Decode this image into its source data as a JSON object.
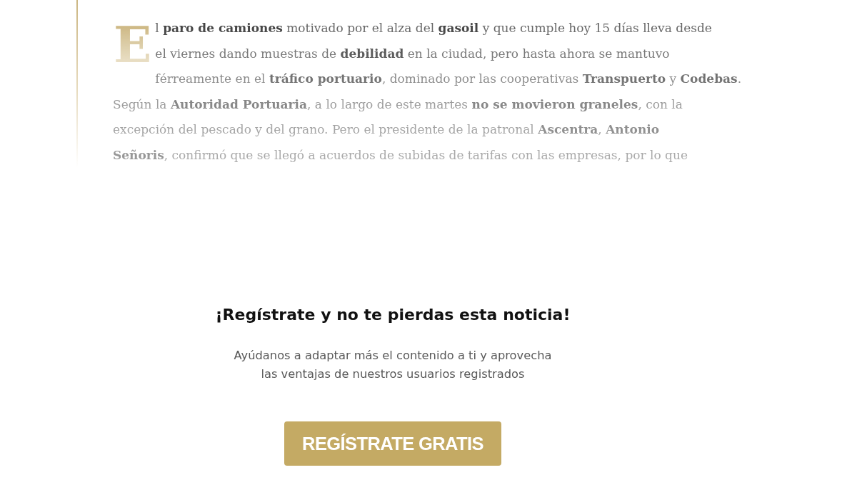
{
  "article": {
    "drop_cap": "E",
    "lines": [
      "l **paro de camiones** motivado por el alza del **gasoil** y que cumple hoy 15 días lleva desde",
      "el viernes dando muestras de **debilidad** en la ciudad, pero hasta ahora se mantuvo",
      "férreamente en el **tráfico portuario**, dominado por las cooperativas **Transpuerto** y **Codebas**.",
      "Según la **Autoridad Portuaria**, a lo largo de este martes **no se movieron graneles**, con la",
      "excepción del pescado y del grano. Pero el presidente de la patronal **Ascentra**, **Antonio**",
      "**Señoris**, confirmó que se llegó a acuerdos de subidas de tarifas con las empresas, por lo que"
    ]
  },
  "paywall": {
    "title": "¡Regístrate y no te pierdas esta noticia!",
    "message": "Ayúdanos a adaptar más el contenido a ti y aprovecha las ventajas de nuestros usuarios registrados",
    "button": "REGÍSTRATE GRATIS"
  }
}
